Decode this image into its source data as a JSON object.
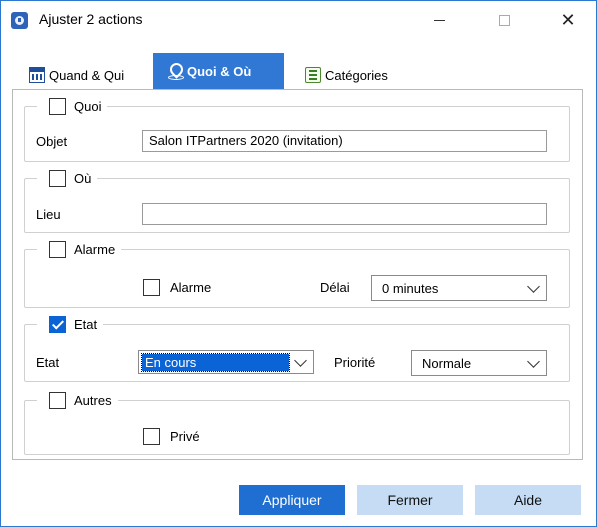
{
  "window": {
    "title": "Ajuster 2 actions",
    "icons": {
      "app": "app-icon",
      "minimize": "minimize-icon",
      "maximize": "maximize-icon",
      "close": "close-icon"
    },
    "close_glyph": "✕"
  },
  "tabs": [
    {
      "label": "Quand & Qui",
      "icon": "calendar-icon",
      "active": false
    },
    {
      "label": "Quoi & Où",
      "icon": "map-pin-icon",
      "active": true
    },
    {
      "label": "Catégories",
      "icon": "tag-icon",
      "active": false
    }
  ],
  "groups": {
    "quoi": {
      "title": "Quoi",
      "checked": false,
      "objet_label": "Objet",
      "objet_value": "Salon ITPartners 2020 (invitation)"
    },
    "ou": {
      "title": "Où",
      "checked": false,
      "lieu_label": "Lieu",
      "lieu_value": ""
    },
    "alarme": {
      "title": "Alarme",
      "checked": false,
      "alarme_check_label": "Alarme",
      "alarme_checked": false,
      "delai_label": "Délai",
      "delai_value": "0 minutes"
    },
    "etat": {
      "title": "Etat",
      "checked": true,
      "etat_label": "Etat",
      "etat_value": "En cours",
      "priorite_label": "Priorité",
      "priorite_value": "Normale"
    },
    "autres": {
      "title": "Autres",
      "checked": false,
      "prive_label": "Privé",
      "prive_checked": false
    }
  },
  "buttons": {
    "apply": "Appliquer",
    "close": "Fermer",
    "help": "Aide"
  },
  "colors": {
    "accent": "#1e6fd1",
    "active_tab": "#3178d4",
    "secondary_button": "#c5dcf4",
    "window_border": "#2b78d0"
  }
}
